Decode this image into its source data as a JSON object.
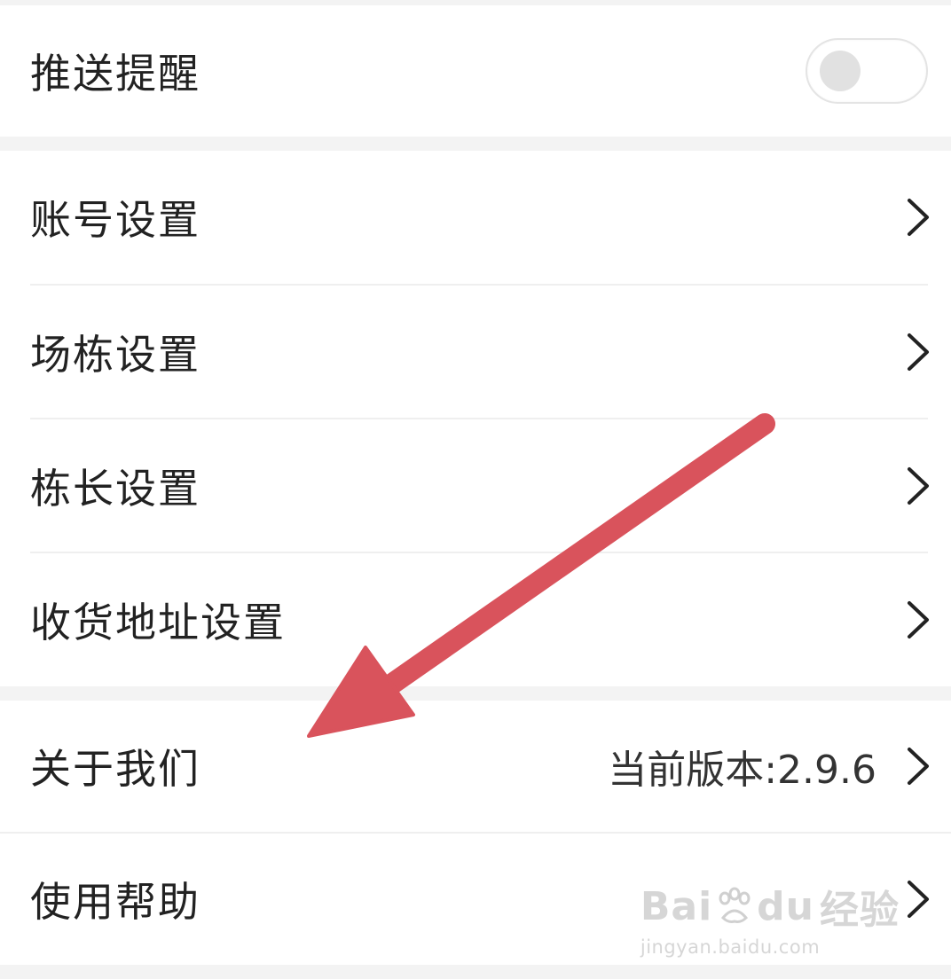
{
  "settings": {
    "push": {
      "label": "推送提醒",
      "enabled": false
    },
    "account": {
      "label": "账号设置"
    },
    "farm": {
      "label": "场栋设置"
    },
    "building_head": {
      "label": "栋长设置"
    },
    "address": {
      "label": "收货地址设置"
    },
    "about": {
      "label": "关于我们",
      "version": "当前版本:2.9.6"
    },
    "help": {
      "label": "使用帮助"
    }
  },
  "icons": {
    "chevron": "chevron-right-icon",
    "toggle": "toggle-switch",
    "annotation": "red-arrow-annotation"
  },
  "colors": {
    "background": "#f3f3f3",
    "card": "#ffffff",
    "text": "#222222",
    "arrow": "#d9535c",
    "toggle_off": "#e1e1e1"
  },
  "watermark": {
    "brand_left": "Bai",
    "brand_right": "du",
    "brand_cn": "经验",
    "url": "jingyan.baidu.com"
  }
}
